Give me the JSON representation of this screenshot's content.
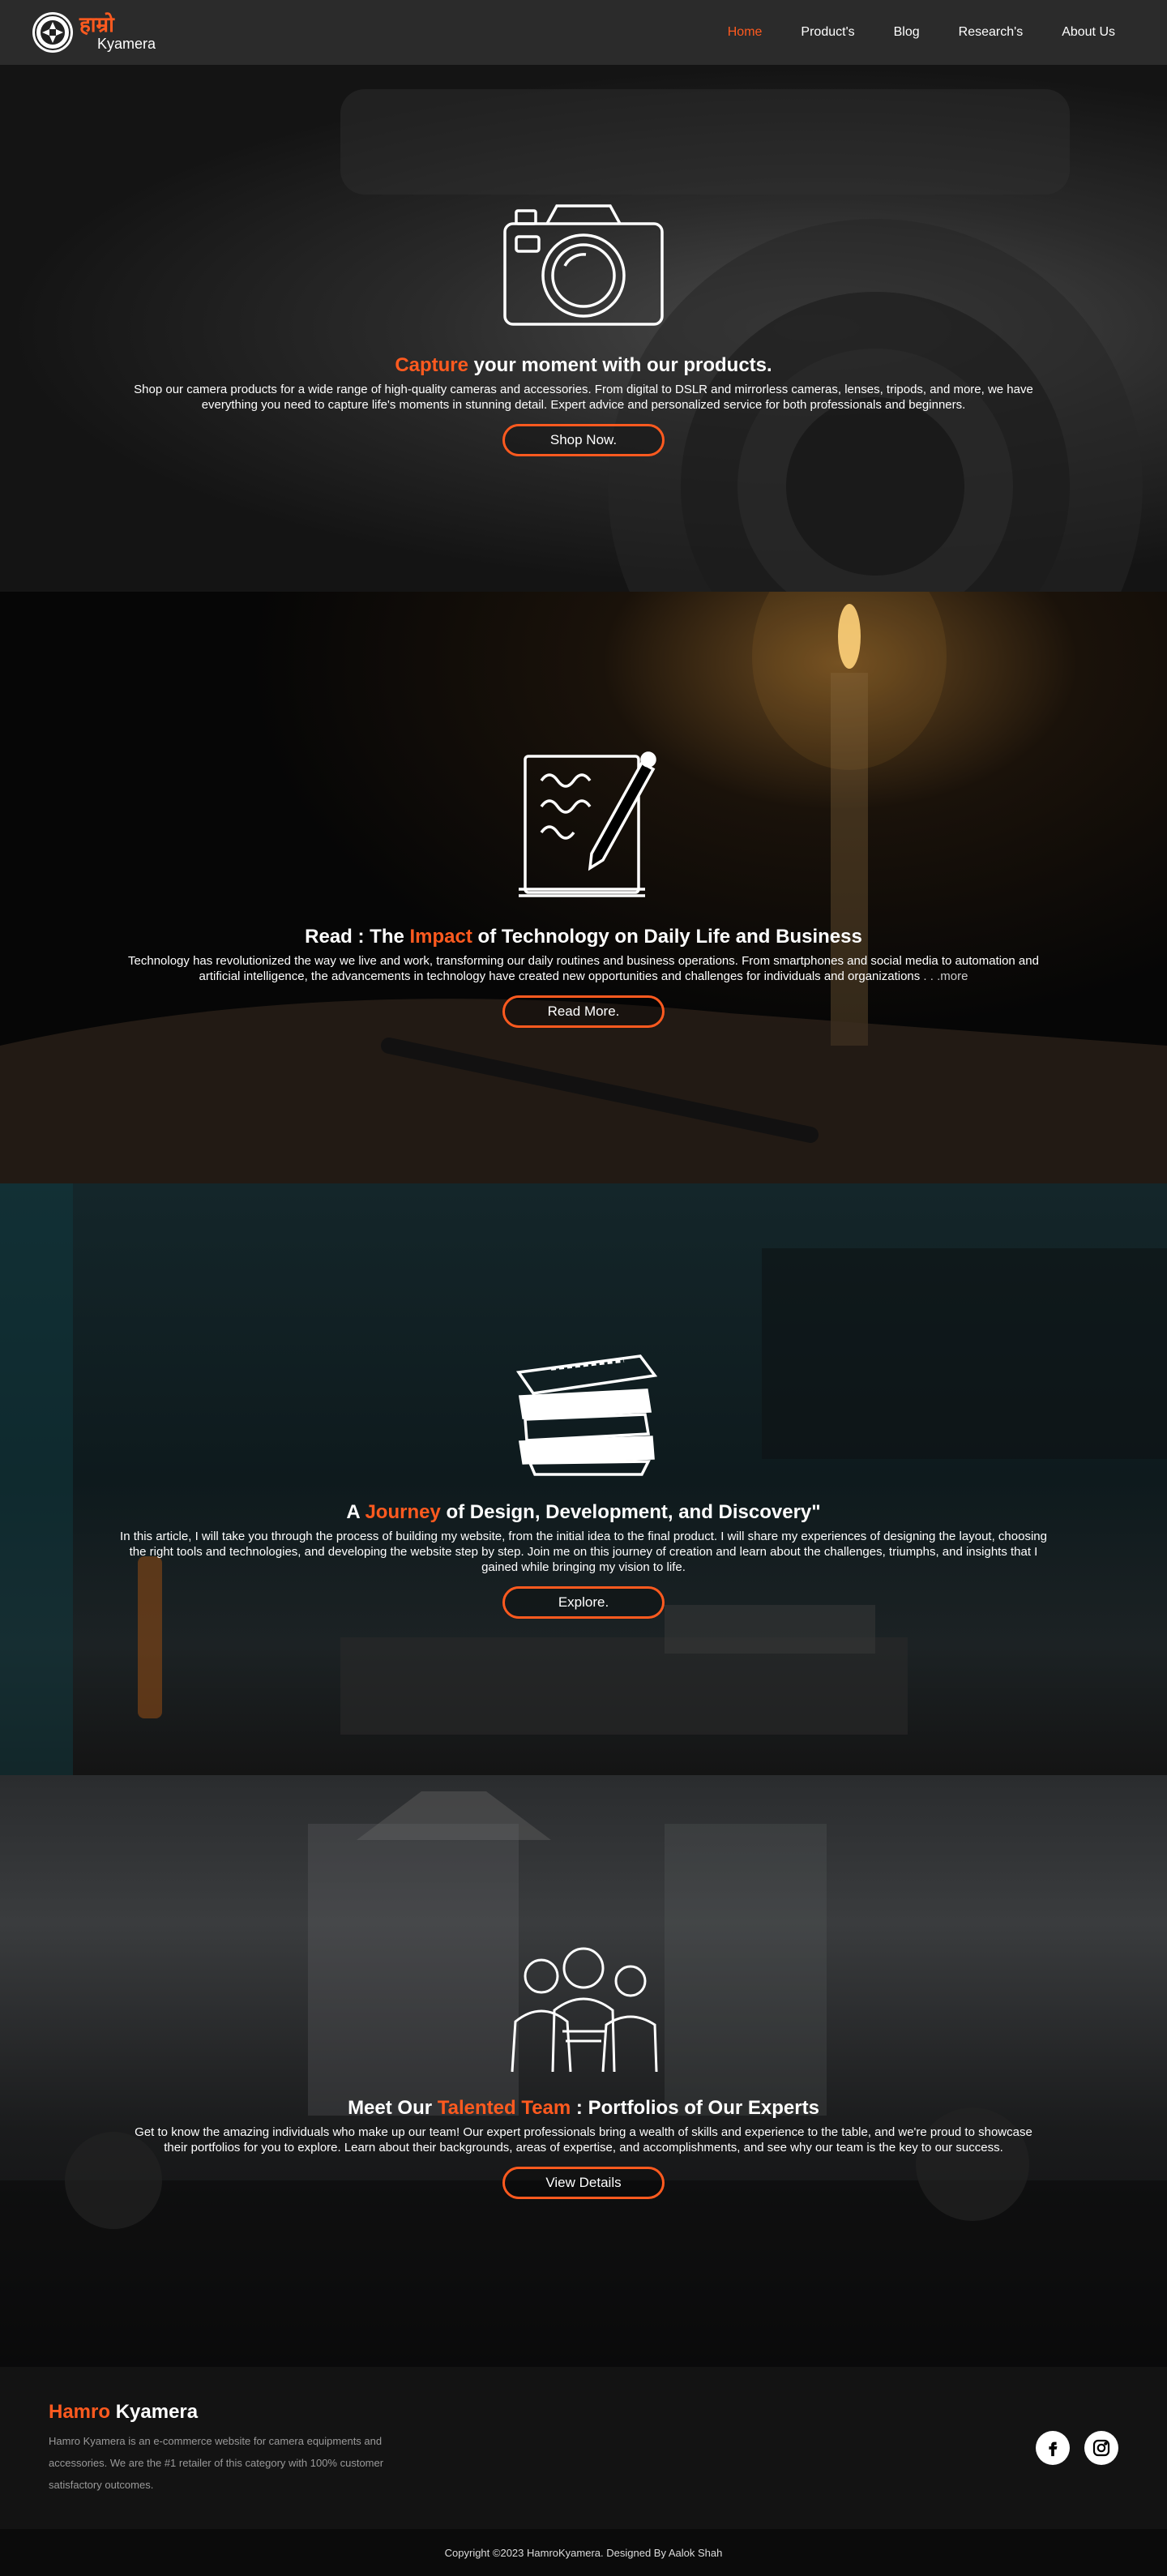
{
  "colors": {
    "accent": "#ff5a1f",
    "nav_bg": "#2b2b2b",
    "footer_bg": "#131313"
  },
  "brand": {
    "top": "हाम्रो",
    "bottom": "Kyamera",
    "logo_icon": "camera-aperture-icon"
  },
  "nav": [
    {
      "label": "Home",
      "active": true
    },
    {
      "label": "Product's"
    },
    {
      "label": "Blog"
    },
    {
      "label": "Research's"
    },
    {
      "label": "About Us"
    }
  ],
  "sections": [
    {
      "icon": "camera-icon",
      "title_accent": "Capture",
      "title_rest": " your moment with our products.",
      "desc": "Shop our camera products for a wide range of high-quality cameras and accessories. From digital to DSLR and mirrorless cameras, lenses, tripods, and more, we have everything you need to capture life's moments in stunning detail. Expert advice and personalized service for both professionals and beginners.",
      "button": "Shop Now."
    },
    {
      "icon": "notebook-pen-icon",
      "title_pre": "Read : The ",
      "title_accent": "Impact",
      "title_rest": " of Technology on Daily Life and Business",
      "desc": "Technology has revolutionized the way we live and work, transforming our daily routines and business operations. From smartphones and social media to automation and artificial intelligence, the advancements in technology have created new opportunities and challenges for individuals and organizations",
      "more": " . . .more",
      "button": "Read More."
    },
    {
      "icon": "book-stack-icon",
      "title_pre": "A ",
      "title_accent": "Journey",
      "title_rest": " of Design, Development, and Discovery\"",
      "desc": "In this article, I will take you through the process of building my website, from the initial idea to the final product. I will share my experiences of designing the layout, choosing the right tools and technologies, and developing the website step by step. Join me on this journey of creation and learn about the challenges, triumphs, and insights that I gained while bringing my vision to life.",
      "button": "Explore."
    },
    {
      "icon": "team-people-icon",
      "title_pre": "Meet Our ",
      "title_accent": "Talented Team",
      "title_rest": " : Portfolios of Our Experts",
      "desc": "Get to know the amazing individuals who make up our team! Our expert professionals bring a wealth of skills and experience to the table, and we're proud to showcase their portfolios for you to explore. Learn about their backgrounds, areas of expertise, and accomplishments, and see why our team is the key to our success.",
      "button": "View Details"
    }
  ],
  "footer": {
    "title_accent": "Hamro",
    "title_rest": " Kyamera",
    "desc": "Hamro Kyamera is an e-commerce website for camera equipments and accessories. We are the #1 retailer of this category with 100% customer satisfactory outcomes.",
    "socials": [
      "facebook-icon",
      "instagram-icon"
    ]
  },
  "copyright": "Copyright ©2023 HamroKyamera. Designed By Aalok Shah"
}
